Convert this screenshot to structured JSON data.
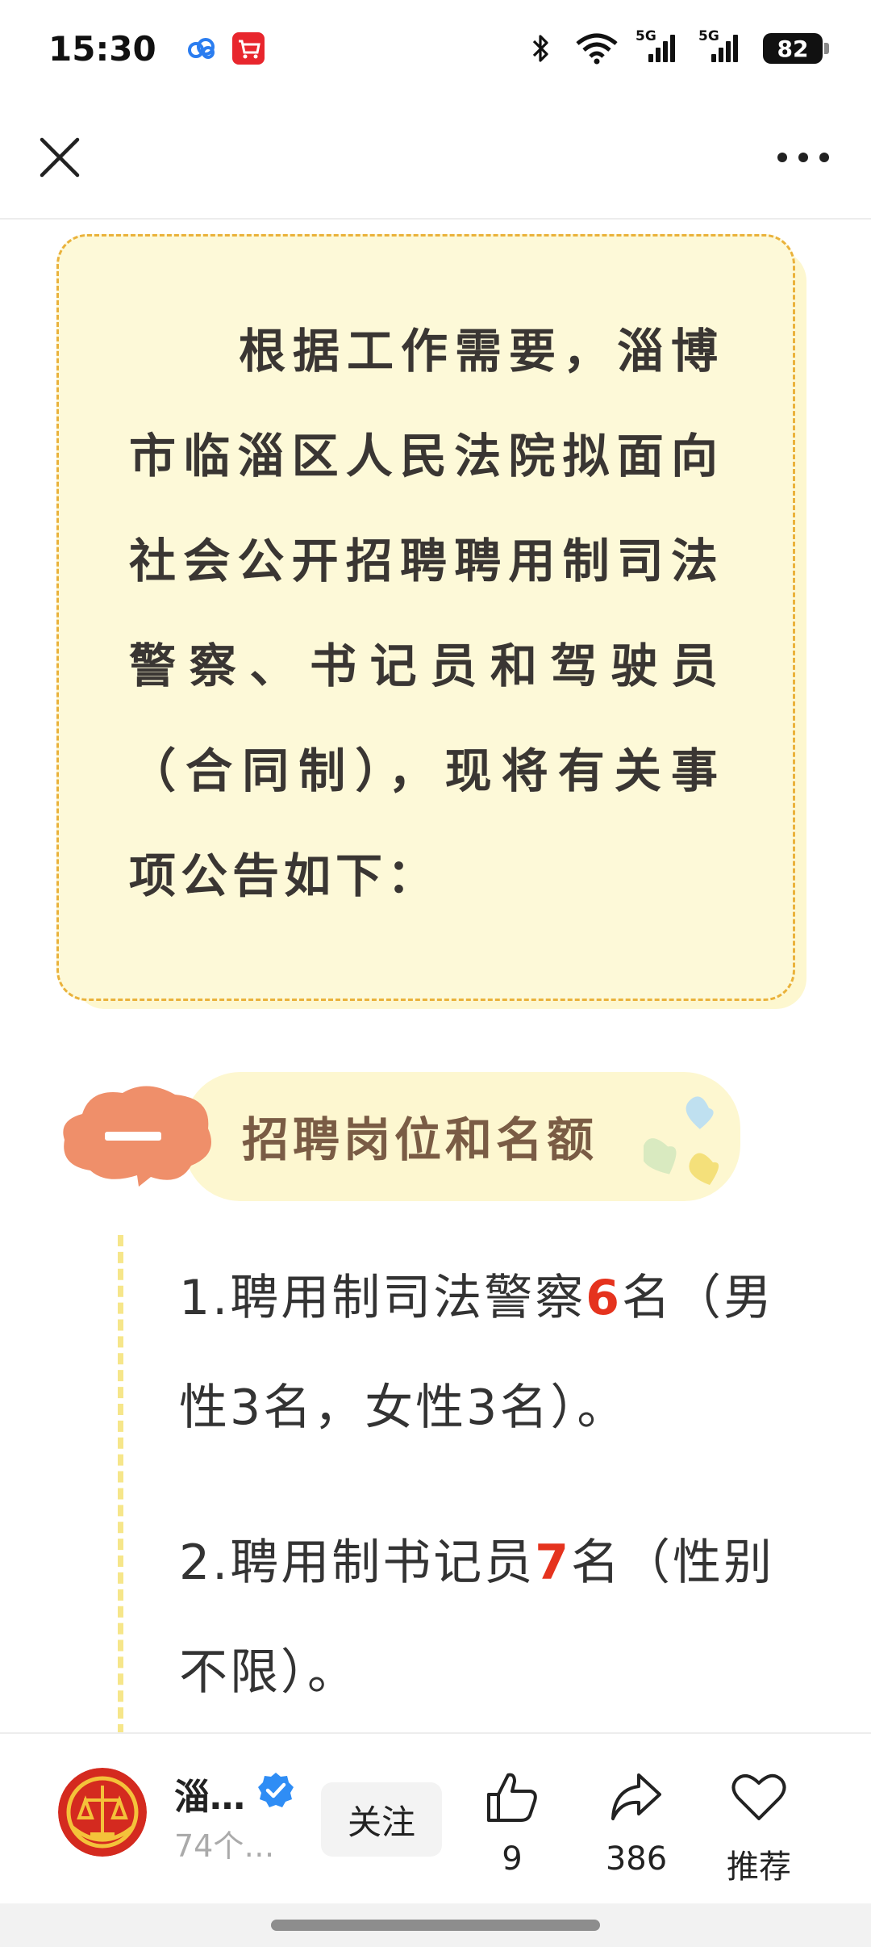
{
  "status_bar": {
    "time": "15:30",
    "network_left": "5G",
    "network_right": "5G",
    "battery": "82"
  },
  "nav": {
    "close_icon": "close-icon",
    "more_icon": "more-horizontal-icon"
  },
  "notice": {
    "text": "根据工作需要，淄博市临淄区人民法院拟面向社会公开招聘聘用制司法警察、书记员和驾驶员（合同制），现将有关事项公告如下："
  },
  "section": {
    "number": "一",
    "title": "招聘岗位和名额"
  },
  "items": [
    {
      "prefix": "1.聘用制司法警察",
      "count": "6",
      "suffix": "名（男性3名，女性3名）。"
    },
    {
      "prefix": "2.聘用制书记员",
      "count": "7",
      "suffix": "名（性别不限）。"
    }
  ],
  "bottom_bar": {
    "author_name": "淄…",
    "author_sub": "74个…",
    "follow_label": "关注",
    "like_count": "9",
    "share_count": "386",
    "recommend_label": "推荐"
  },
  "colors": {
    "accent_red": "#e5331e",
    "notice_bg": "#fdf9d8",
    "notice_border": "#eab23b",
    "section_title": "#7a5c45",
    "cloud": "#ef8f6a"
  }
}
